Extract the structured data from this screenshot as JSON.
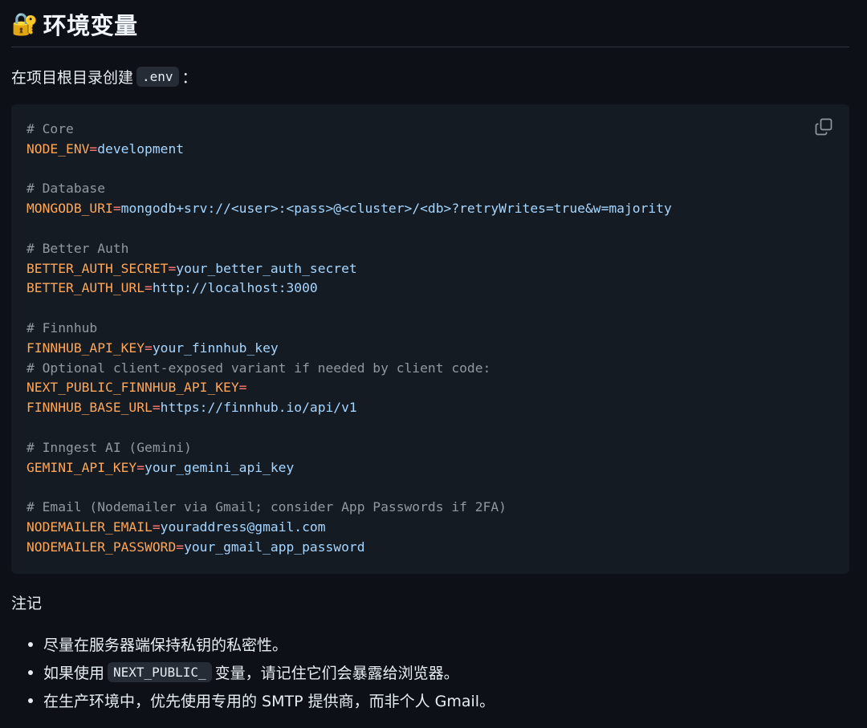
{
  "heading": {
    "emoji": "🔐",
    "text": "环境变量"
  },
  "intro": {
    "text_before": "在项目根目录创建",
    "code": ".env",
    "text_after": "："
  },
  "code_block": {
    "copy_icon": "copy-icon",
    "lines": [
      {
        "type": "comment",
        "text": "# Core"
      },
      {
        "type": "assign",
        "key": "NODE_ENV",
        "value": "development"
      },
      {
        "type": "blank"
      },
      {
        "type": "comment",
        "text": "# Database"
      },
      {
        "type": "assign",
        "key": "MONGODB_URI",
        "value": "mongodb+srv://<user>:<pass>@<cluster>/<db>?retryWrites=true&w=majority"
      },
      {
        "type": "blank"
      },
      {
        "type": "comment",
        "text": "# Better Auth"
      },
      {
        "type": "assign",
        "key": "BETTER_AUTH_SECRET",
        "value": "your_better_auth_secret"
      },
      {
        "type": "assign",
        "key": "BETTER_AUTH_URL",
        "value": "http://localhost:3000"
      },
      {
        "type": "blank"
      },
      {
        "type": "comment",
        "text": "# Finnhub"
      },
      {
        "type": "assign",
        "key": "FINNHUB_API_KEY",
        "value": "your_finnhub_key"
      },
      {
        "type": "comment",
        "text": "# Optional client-exposed variant if needed by client code:"
      },
      {
        "type": "assign",
        "key": "NEXT_PUBLIC_FINNHUB_API_KEY",
        "value": ""
      },
      {
        "type": "assign",
        "key": "FINNHUB_BASE_URL",
        "value": "https://finnhub.io/api/v1"
      },
      {
        "type": "blank"
      },
      {
        "type": "comment",
        "text": "# Inngest AI (Gemini)"
      },
      {
        "type": "assign",
        "key": "GEMINI_API_KEY",
        "value": "your_gemini_api_key"
      },
      {
        "type": "blank"
      },
      {
        "type": "comment",
        "text": "# Email (Nodemailer via Gmail; consider App Passwords if 2FA)"
      },
      {
        "type": "assign",
        "key": "NODEMAILER_EMAIL",
        "value": "youraddress@gmail.com"
      },
      {
        "type": "assign",
        "key": "NODEMAILER_PASSWORD",
        "value": "your_gmail_app_password"
      }
    ]
  },
  "notes": {
    "label": "注记",
    "items": [
      {
        "before": "尽量在服务器端保持私钥的私密性。",
        "code": "",
        "after": ""
      },
      {
        "before": "如果使用",
        "code": "NEXT_PUBLIC_",
        "after": "变量，请记住它们会暴露给浏览器。"
      },
      {
        "before": "在生产环境中，优先使用专用的 SMTP 提供商，而非个人 Gmail。",
        "code": "",
        "after": ""
      }
    ]
  },
  "colors": {
    "background": "#0d1117",
    "code_background": "#151b23",
    "comment": "#9198a1",
    "key": "#ffa657",
    "equals": "#ff7b72",
    "value": "#a5d6ff"
  }
}
